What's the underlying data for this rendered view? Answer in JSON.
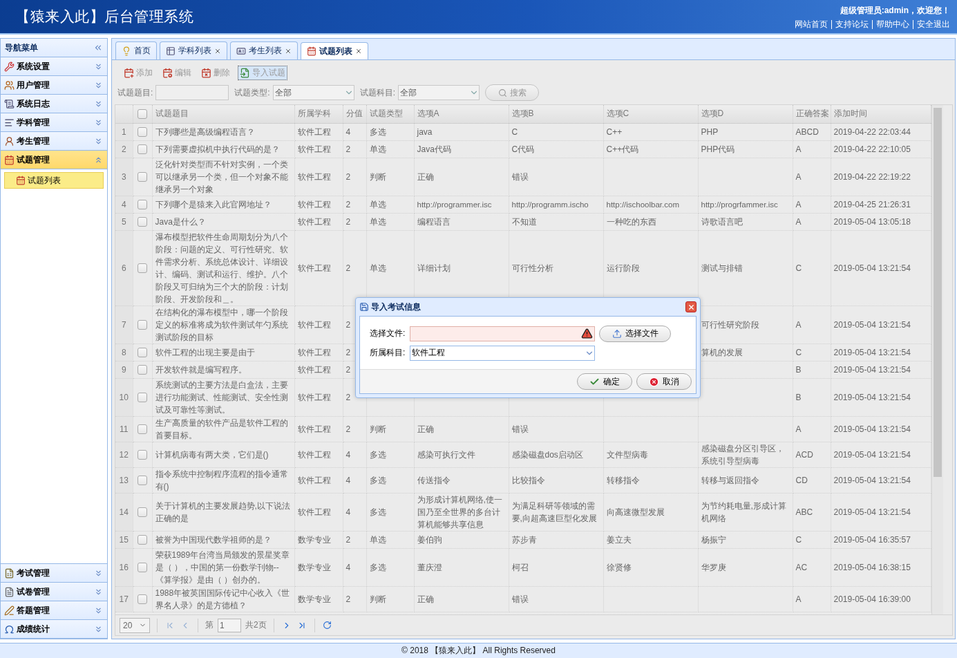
{
  "header": {
    "title": "【猿来入此】后台管理系统",
    "greeting": "超级管理员:admin，欢迎您！",
    "links": [
      "网站首页",
      "支持论坛",
      "帮助中心",
      "安全退出"
    ]
  },
  "sidebar": {
    "title": "导航菜单",
    "groups": [
      {
        "label": "系统设置",
        "expanded": false,
        "selected": false
      },
      {
        "label": "用户管理",
        "expanded": false,
        "selected": false
      },
      {
        "label": "系统日志",
        "expanded": false,
        "selected": false
      },
      {
        "label": "学科管理",
        "expanded": false,
        "selected": false
      },
      {
        "label": "考生管理",
        "expanded": false,
        "selected": false
      },
      {
        "label": "试题管理",
        "expanded": true,
        "selected": true,
        "children": [
          {
            "label": "试题列表",
            "selected": true
          }
        ]
      },
      {
        "label": "考试管理",
        "expanded": false,
        "selected": false
      },
      {
        "label": "试卷管理",
        "expanded": false,
        "selected": false
      },
      {
        "label": "答题管理",
        "expanded": false,
        "selected": false
      },
      {
        "label": "成绩统计",
        "expanded": false,
        "selected": false
      }
    ]
  },
  "tabs": [
    {
      "label": "首页",
      "closable": false,
      "selected": false
    },
    {
      "label": "学科列表",
      "closable": true,
      "selected": false
    },
    {
      "label": "考生列表",
      "closable": true,
      "selected": false
    },
    {
      "label": "试题列表",
      "closable": true,
      "selected": true
    }
  ],
  "toolbar": [
    {
      "label": "添加",
      "focused": false
    },
    {
      "label": "编辑",
      "focused": false
    },
    {
      "label": "删除",
      "focused": false
    },
    {
      "label": "导入试题",
      "focused": true
    }
  ],
  "search": [
    {
      "kind": "text",
      "label": "试题题目:"
    },
    {
      "kind": "select",
      "label": "试题类型:",
      "value": "全部"
    },
    {
      "kind": "select",
      "label": "试题科目:",
      "value": "全部"
    },
    {
      "kind": "button",
      "label": "搜索"
    }
  ],
  "table": {
    "all_checked": false,
    "columns": [
      "试题题目",
      "所属学科",
      "分值",
      "试题类型",
      "选项A",
      "选项B",
      "选项C",
      "选项D",
      "正确答案",
      "添加时间"
    ],
    "rows": [
      {
        "no": "1",
        "checked": false,
        "cells": {
          "question": "下列哪些是高级编程语言？",
          "subject": "软件工程",
          "score": "4",
          "type": "多选",
          "a": "java",
          "b": "C",
          "c": "C++",
          "d": "PHP",
          "answer": "ABCD",
          "time": "2019-04-22 22:03:44"
        }
      },
      {
        "no": "2",
        "checked": false,
        "cells": {
          "question": "下列需要虚拟机中执行代码的是？",
          "subject": "软件工程",
          "score": "2",
          "type": "单选",
          "a": "Java代码",
          "b": "C代码",
          "c": "C++代码",
          "d": "PHP代码",
          "answer": "A",
          "time": "2019-04-22 22:10:05"
        }
      },
      {
        "no": "3",
        "checked": false,
        "cells": {
          "question": "泛化针对类型而不针对实例，一个类可以继承另一个类，但一个对象不能继承另一个对象",
          "subject": "软件工程",
          "score": "2",
          "type": "判断",
          "a": "正确",
          "b": "错误",
          "answer": "A",
          "time": "2019-04-22 22:19:22"
        }
      },
      {
        "no": "4",
        "checked": false,
        "cells": {
          "question": "下列哪个是猿来入此官网地址？",
          "subject": "软件工程",
          "score": "2",
          "type": "单选",
          "a": "http://programmer.isc",
          "b": "http://programm.ischo",
          "c": "http://ischoolbar.com",
          "d": "http://progrfammer.isc",
          "answer": "A",
          "time": "2019-04-25 21:26:31"
        }
      },
      {
        "no": "5",
        "checked": false,
        "cells": {
          "question": "Java是什么？",
          "subject": "软件工程",
          "score": "2",
          "type": "单选",
          "a": "编程语言",
          "b": "不知道",
          "c": "一种吃的东西",
          "d": "诗歌语言吧",
          "answer": "A",
          "time": "2019-05-04 13:05:18"
        }
      },
      {
        "no": "6",
        "checked": false,
        "cells": {
          "question": "瀑布模型把软件生命周期划分为八个阶段：问题的定义、可行性研究、软件需求分析、系统总体设计、详细设计、编码、测试和运行、维护。八个阶段又可归纳为三个大的阶段：计划阶段、开发阶段和＿。",
          "subject": "软件工程",
          "score": "2",
          "type": "单选",
          "a": "详细计划",
          "b": "可行性分析",
          "c": "运行阶段",
          "d": "测试与排错",
          "answer": "C",
          "time": "2019-05-04 13:21:54"
        }
      },
      {
        "no": "7",
        "checked": false,
        "cells": {
          "question": "在结构化的瀑布模型中，哪一个阶段定义的标准将成为软件测试年勺系统测试阶段的目标",
          "subject": "软件工程",
          "score": "2",
          "d": "可行性研究阶段",
          "answer": "A",
          "time": "2019-05-04 13:21:54"
        }
      },
      {
        "no": "8",
        "checked": false,
        "cells": {
          "question": "软件工程的出现主要是由于",
          "subject": "软件工程",
          "score": "2",
          "d": "算机的发展",
          "answer": "C",
          "time": "2019-05-04 13:21:54"
        }
      },
      {
        "no": "9",
        "checked": false,
        "cells": {
          "question": "开发软件就是编写程序。",
          "subject": "软件工程",
          "score": "2",
          "answer": "B",
          "time": "2019-05-04 13:21:54"
        }
      },
      {
        "no": "10",
        "checked": false,
        "cells": {
          "question": "系统测试的主要方法是白盒法，主要进行功能测试、性能测试、安全性测试及可靠性等测试。",
          "subject": "软件工程",
          "score": "2",
          "answer": "B",
          "time": "2019-05-04 13:21:54"
        }
      },
      {
        "no": "11",
        "checked": false,
        "cells": {
          "question": "生产高质量的软件产品是软件工程的首要目标。",
          "subject": "软件工程",
          "score": "2",
          "type": "判断",
          "a": "正确",
          "b": "错误",
          "answer": "A",
          "time": "2019-05-04 13:21:54"
        }
      },
      {
        "no": "12",
        "checked": false,
        "cells": {
          "question": "计算机病毒有两大类，它们是()",
          "subject": "软件工程",
          "score": "4",
          "type": "多选",
          "a": "感染可执行文件",
          "b": "感染磁盘dos启动区",
          "c": "文件型病毒",
          "d": "感染磁盘分区引导区，系统引导型病毒",
          "answer": "ACD",
          "time": "2019-05-04 13:21:54"
        }
      },
      {
        "no": "13",
        "checked": false,
        "cells": {
          "question": "指令系统中控制程序流程的指令通常有()",
          "subject": "软件工程",
          "score": "4",
          "type": "多选",
          "a": "传送指令",
          "b": "比较指令",
          "c": "转移指令",
          "d": "转移与返回指令",
          "answer": "CD",
          "time": "2019-05-04 13:21:54"
        }
      },
      {
        "no": "14",
        "checked": false,
        "cells": {
          "question": "关于计算机的主要发展趋势,以下说法正确的是",
          "subject": "软件工程",
          "score": "4",
          "type": "多选",
          "a": "为形成计算机网络,使一国乃至全世界的多台计算机能够共享信息",
          "b": "为满足科研等领域的需要,向超高速巨型化发展",
          "c": "向高速微型发展",
          "d": "为节约耗电量,形成计算机网络",
          "answer": "ABC",
          "time": "2019-05-04 13:21:54"
        }
      },
      {
        "no": "15",
        "checked": false,
        "cells": {
          "question": "被誉为中国现代数学祖师的是？",
          "subject": "数学专业",
          "score": "2",
          "type": "单选",
          "a": "姜伯驹",
          "b": "苏步青",
          "c": "姜立夫",
          "d": "杨振宁",
          "answer": "C",
          "time": "2019-05-04 16:35:57"
        }
      },
      {
        "no": "16",
        "checked": false,
        "cells": {
          "question": "荣获1989年台湾当局颁发的景星奖章是（ ），中国的第一份数学刊物--《算学报》是由（ ）创办的。",
          "subject": "数学专业",
          "score": "4",
          "type": "多选",
          "a": "董庆澄",
          "b": "柯召",
          "c": "徐贤修",
          "d": "华罗庚",
          "answer": "AC",
          "time": "2019-05-04 16:38:15"
        }
      },
      {
        "no": "17",
        "checked": false,
        "cells": {
          "question": "1988年被英国国际传记中心收入《世界名人录》的是方德植？",
          "subject": "数学专业",
          "score": "2",
          "type": "判断",
          "a": "正确",
          "b": "错误",
          "answer": "A",
          "time": "2019-05-04 16:39:00"
        }
      }
    ]
  },
  "pager": {
    "page_size": "20",
    "page_prefix": "第",
    "page": "1",
    "page_total": "共2页"
  },
  "dialog": {
    "title": "导入考试信息",
    "fields": [
      {
        "kind": "file",
        "label": "选择文件:",
        "invalid": true,
        "button": "选择文件"
      },
      {
        "kind": "select",
        "label": "所属科目:",
        "value": "软件工程"
      }
    ],
    "buttons": [
      {
        "kind": "ok",
        "label": "确定"
      },
      {
        "kind": "cancel",
        "label": "取消"
      }
    ]
  },
  "footer": "© 2018 【猿来入此】 All Rights Reserved"
}
